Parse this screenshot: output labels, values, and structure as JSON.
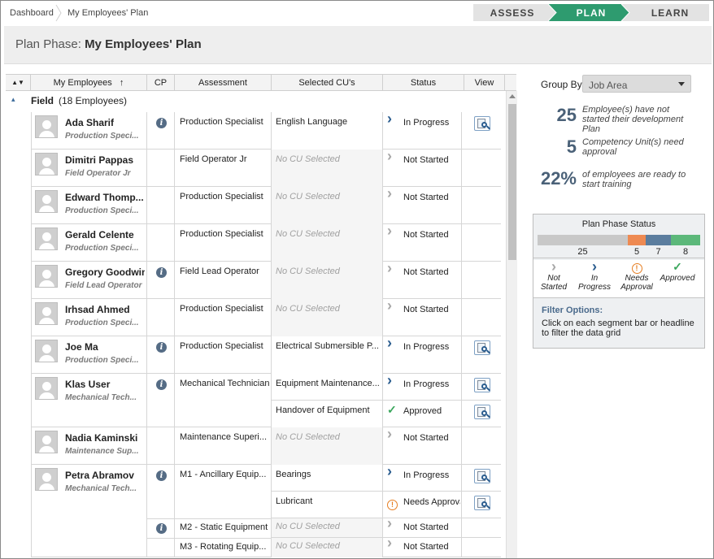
{
  "breadcrumb": [
    "Dashboard",
    "My Employees' Plan"
  ],
  "steps": [
    {
      "label": "ASSESS",
      "active": false
    },
    {
      "label": "PLAN",
      "active": true
    },
    {
      "label": "LEARN",
      "active": false
    }
  ],
  "header": {
    "prefix": "Plan Phase:",
    "title": "My Employees' Plan"
  },
  "grid": {
    "columns": {
      "sort": "▲▼",
      "employees": "My Employees",
      "sort_arrow": "↑",
      "cp": "CP",
      "assessment": "Assessment",
      "cus": "Selected CU's",
      "status": "Status",
      "view": "View"
    },
    "group": {
      "expander": "▴",
      "name": "Field",
      "count": "(18 Employees)"
    },
    "employees": [
      {
        "name": "Ada Sharif",
        "role": "Production Speci...",
        "cp": true,
        "assessments": [
          {
            "name": "Production Specialist",
            "cus": [
              {
                "cu": "English Language",
                "status": "In Progress",
                "icon": "chevron",
                "view": true
              }
            ]
          }
        ]
      },
      {
        "name": "Dimitri Pappas",
        "role": "Field Operator Jr",
        "cp": false,
        "assessments": [
          {
            "name": "Field Operator Jr",
            "cus": [
              {
                "cu": "No CU Selected",
                "status": "Not Started",
                "icon": "chevron-gray",
                "view": false
              }
            ]
          }
        ]
      },
      {
        "name": "Edward Thomp...",
        "role": "Production Speci...",
        "cp": false,
        "assessments": [
          {
            "name": "Production Specialist",
            "cus": [
              {
                "cu": "No CU Selected",
                "status": "Not Started",
                "icon": "chevron-gray",
                "view": false
              }
            ]
          }
        ]
      },
      {
        "name": "Gerald Celente",
        "role": "Production Speci...",
        "cp": false,
        "assessments": [
          {
            "name": "Production Specialist",
            "cus": [
              {
                "cu": "No CU Selected",
                "status": "Not Started",
                "icon": "chevron-gray",
                "view": false
              }
            ]
          }
        ]
      },
      {
        "name": "Gregory Goodwin",
        "role": "Field Lead Operator",
        "cp": true,
        "assessments": [
          {
            "name": "Field Lead Operator",
            "cus": [
              {
                "cu": "No CU Selected",
                "status": "Not Started",
                "icon": "chevron-gray",
                "view": false
              }
            ]
          }
        ]
      },
      {
        "name": "Irhsad Ahmed",
        "role": "Production Speci...",
        "cp": false,
        "assessments": [
          {
            "name": "Production Specialist",
            "cus": [
              {
                "cu": "No CU Selected",
                "status": "Not Started",
                "icon": "chevron-gray",
                "view": false
              }
            ]
          }
        ]
      },
      {
        "name": "Joe Ma",
        "role": "Production Speci...",
        "cp": true,
        "assessments": [
          {
            "name": "Production Specialist",
            "cus": [
              {
                "cu": "Electrical Submersible P...",
                "status": "In Progress",
                "icon": "chevron",
                "view": true
              }
            ]
          }
        ]
      },
      {
        "name": "Klas User",
        "role": "Mechanical Tech...",
        "cp": true,
        "assessments": [
          {
            "name": "Mechanical Technician",
            "cus": [
              {
                "cu": "Equipment Maintenance...",
                "status": "In Progress",
                "icon": "chevron",
                "view": true
              },
              {
                "cu": "Handover of Equipment",
                "status": "Approved",
                "icon": "check",
                "view": true
              }
            ]
          }
        ]
      },
      {
        "name": "Nadia Kaminski",
        "role": "Maintenance Sup...",
        "cp": false,
        "assessments": [
          {
            "name": "Maintenance Superi...",
            "cus": [
              {
                "cu": "No CU Selected",
                "status": "Not Started",
                "icon": "chevron-gray",
                "view": false
              }
            ]
          }
        ]
      },
      {
        "name": "Petra Abramov",
        "role": "Mechanical Tech...",
        "cp": true,
        "assessments": [
          {
            "name": "M1 - Ancillary Equip...",
            "cus": [
              {
                "cu": "Bearings",
                "status": "In Progress",
                "icon": "chevron",
                "view": true
              },
              {
                "cu": "Lubricant",
                "status": "Needs Approval",
                "icon": "warn",
                "view": true
              }
            ]
          },
          {
            "name": "M2 - Static Equipment",
            "cp": true,
            "cus": [
              {
                "cu": "No CU Selected",
                "status": "Not Started",
                "icon": "chevron-gray",
                "view": false
              }
            ]
          },
          {
            "name": "M3 - Rotating Equip...",
            "cp": false,
            "cus": [
              {
                "cu": "No CU Selected",
                "status": "Not Started",
                "icon": "chevron-gray",
                "view": false
              }
            ]
          }
        ]
      }
    ]
  },
  "sidebar": {
    "group_by_label": "Group By",
    "group_by_value": "Job Area",
    "kpis": [
      {
        "value": "25",
        "text": "Employee(s) have not started their development Plan"
      },
      {
        "value": "5",
        "text": "Competency Unit(s) need approval"
      },
      {
        "value": "22%",
        "text": "of employees are ready to start training"
      }
    ],
    "status": {
      "title": "Plan Phase Status",
      "segments": [
        {
          "value": 25,
          "color": "#c8c8c8"
        },
        {
          "value": 5,
          "color": "#ee8a52"
        },
        {
          "value": 7,
          "color": "#5b7d9e"
        },
        {
          "value": 8,
          "color": "#5cb87a"
        }
      ],
      "legend": [
        {
          "icon": "chevron-gray",
          "glyph": "›",
          "label": "Not Started"
        },
        {
          "icon": "chevron",
          "glyph": "›",
          "label": "In Progress"
        },
        {
          "icon": "warn",
          "glyph": "!",
          "label": "Needs Approval"
        },
        {
          "icon": "check",
          "glyph": "✓",
          "label": "Approved"
        }
      ]
    },
    "filter_title": "Filter Options:",
    "filter_text": "Click on each segment bar or headline to filter the data grid"
  },
  "colors": {
    "accent": "#2e9b6f",
    "inactive_step": "#e3e3e3",
    "chevron": "#2b5d8f",
    "check": "#3aa65c",
    "warn": "#e67e22"
  }
}
